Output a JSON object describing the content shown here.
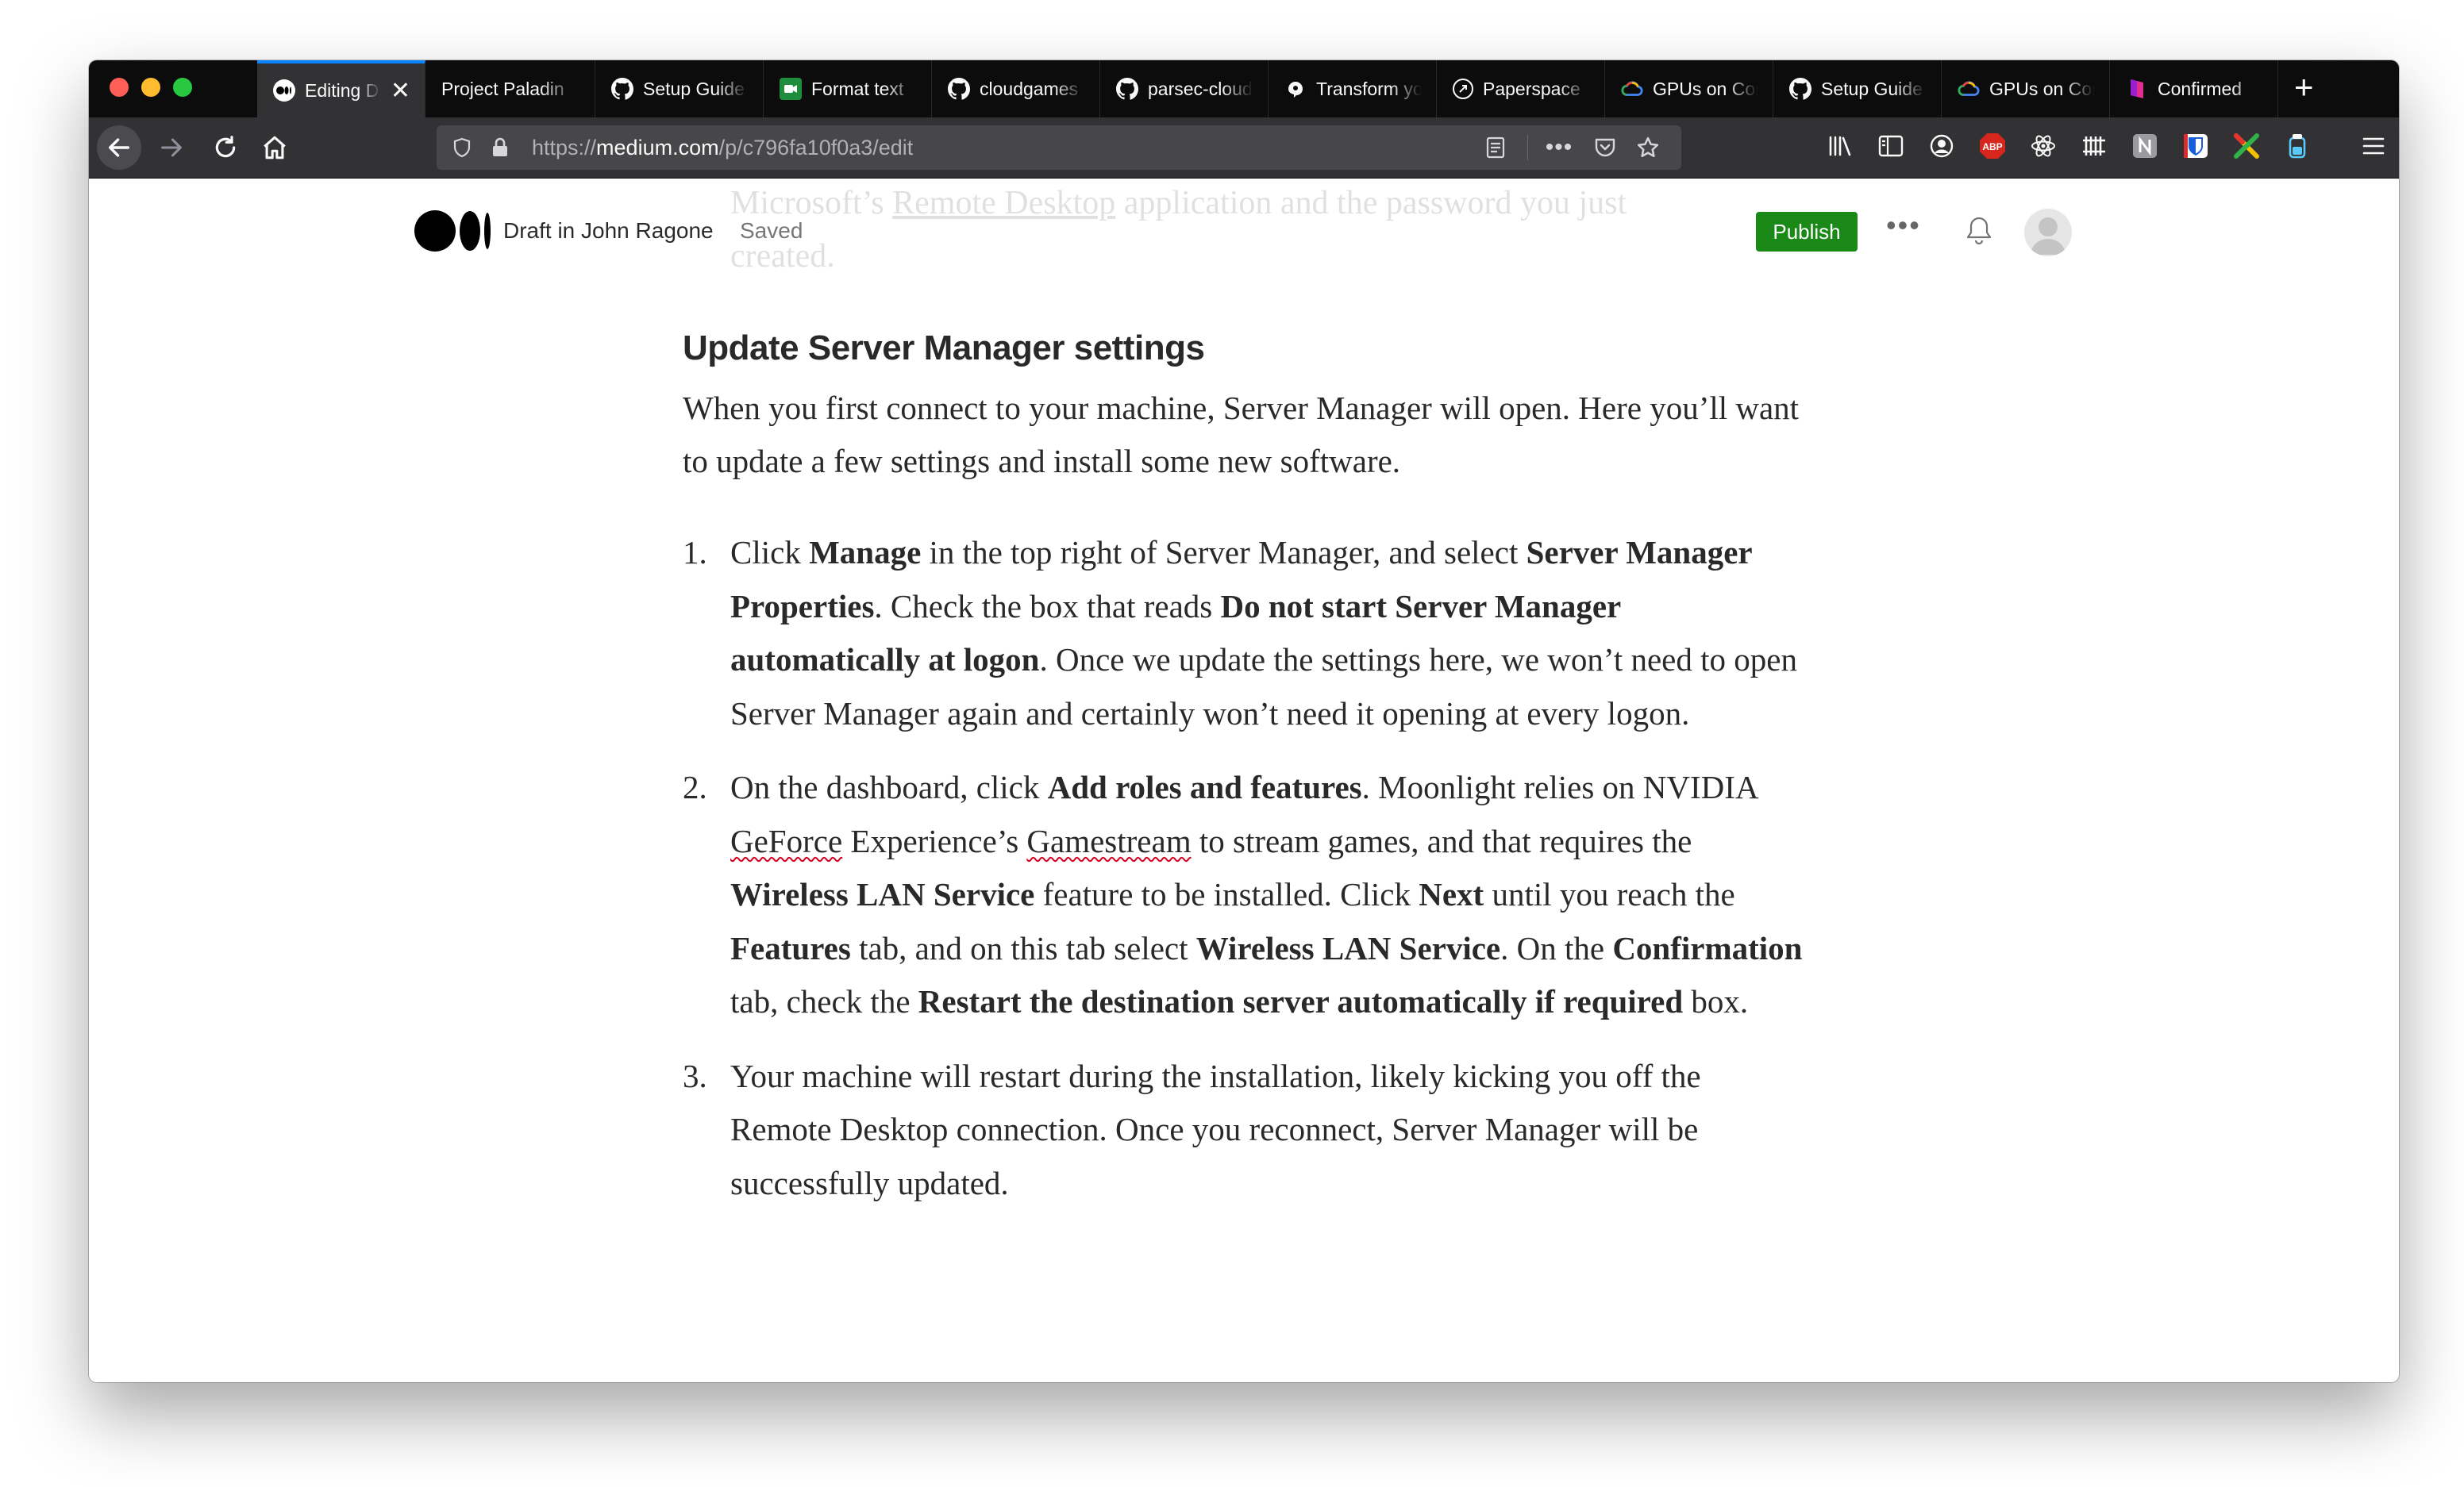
{
  "browser": {
    "tabs": [
      {
        "title": "Editing Draft",
        "icon": "medium-icon",
        "active": true
      },
      {
        "title": "Project Paladin",
        "icon": "",
        "active": false
      },
      {
        "title": "Setup Guide",
        "icon": "github-icon",
        "active": false
      },
      {
        "title": "Format text",
        "icon": "meet-icon",
        "active": false
      },
      {
        "title": "cloudgames",
        "icon": "github-icon",
        "active": false
      },
      {
        "title": "parsec-cloud",
        "icon": "github-icon",
        "active": false
      },
      {
        "title": "Transform your",
        "icon": "parsec-icon",
        "active": false
      },
      {
        "title": "Paperspace",
        "icon": "paperspace-icon",
        "active": false
      },
      {
        "title": "GPUs on Compute",
        "icon": "gcloud-icon",
        "active": false
      },
      {
        "title": "Setup Guide",
        "icon": "github-icon",
        "active": false
      },
      {
        "title": "GPUs on Compute",
        "icon": "gcloud-icon",
        "active": false
      },
      {
        "title": "Confirmed",
        "icon": "confirmed-icon",
        "active": false
      }
    ],
    "url": {
      "scheme": "https://",
      "host": "medium.com",
      "path": "/p/c796fa10f0a3/edit"
    }
  },
  "medium": {
    "draft_label": "Draft in John Ragone",
    "saved_label": "Saved",
    "publish_label": "Publish",
    "more_label": "•••"
  },
  "article": {
    "faded_above": {
      "line1_pre": "Microsoft’s ",
      "line1_link": "Remote Desktop",
      "line1_post": " application and the password you just",
      "line2": "created."
    },
    "heading": "Update Server Manager settings",
    "intro": "When you first connect to your machine, Server Manager will open. Here you’ll want to update a few settings and install some new software.",
    "steps": [
      {
        "num": "1.",
        "t1": "Click ",
        "b1": "Manage",
        "t2": " in the top right of Server Manager, and select ",
        "b2": "Server Manager Properties",
        "t3": ". Check the box that reads ",
        "b3": "Do not start Server Manager automatically at logon",
        "t4": ". Once we update the settings here, we won’t need to open Server Manager again and certainly won’t need it opening at every logon."
      },
      {
        "num": "2.",
        "t1": "On the dashboard, click ",
        "b1": "Add roles and features",
        "t2": ". Moonlight relies on NVIDIA ",
        "s1": "GeForce",
        "t3": " Experience’s ",
        "s2": "Gamestream",
        "t4": " to stream games, and that requires the ",
        "b2": "Wireless LAN Service",
        "t5": " feature to be installed. Click ",
        "b3": "Next",
        "t6": " until you reach the ",
        "b4": "Features",
        "t7": " tab, and on this tab select ",
        "b5": "Wireless LAN Service",
        "t8": ". On the ",
        "b6": "Confirmation",
        "t9": " tab, check the ",
        "b7": "Restart the destination server automatically if required",
        "t10": " box."
      },
      {
        "num": "3.",
        "t1": "Your machine will restart during the installation, likely kicking you off the Remote Desktop connection. Once you reconnect, Server Manager will be successfully updated."
      }
    ]
  },
  "colors": {
    "publish_green": "#1a8917",
    "tab_accent": "#0a84ff",
    "spellcheck_red": "#d70022"
  }
}
